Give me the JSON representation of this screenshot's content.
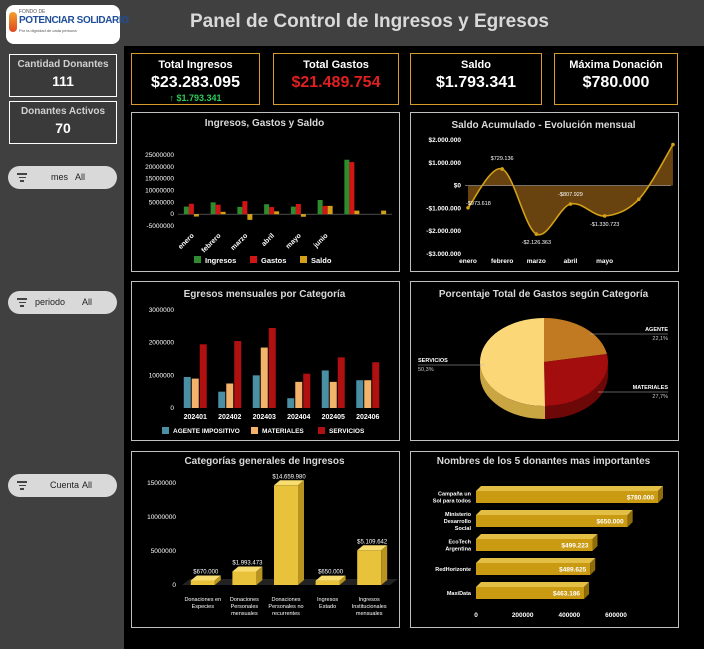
{
  "header": {
    "title": "Panel de Control de Ingresos y Egresos"
  },
  "logo": {
    "small": "FONDO DE",
    "main": "POTENCIAR SOLIDARIO",
    "sub": "Por la dignidad de cada persona"
  },
  "sidebar": {
    "stats": [
      {
        "label": "Cantidad Donantes",
        "value": "111"
      },
      {
        "label": "Donantes Activos",
        "value": "70"
      }
    ],
    "slicers": [
      {
        "label": "mes",
        "value": "All"
      },
      {
        "label": "periodo",
        "value": "All"
      },
      {
        "label": "Cuenta",
        "value": "All"
      }
    ]
  },
  "kpis": [
    {
      "label": "Total Ingresos",
      "value": "$23.283.095",
      "sub": "$1.793.341",
      "color": "#ffffff"
    },
    {
      "label": "Total Gastos",
      "value": "$21.489.754",
      "color": "#e02020"
    },
    {
      "label": "Saldo",
      "value": "$1.793.341",
      "color": "#ffffff"
    },
    {
      "label": "Máxima Donación",
      "value": "$780.000",
      "color": "#ffffff"
    }
  ],
  "colors": {
    "ingresos": "#2e8b2e",
    "gastos": "#d11414",
    "saldo": "#d4a017",
    "agente": "#4a8fa3",
    "materiales": "#f4b36a",
    "servicios": "#b01010",
    "gold": "#e8c23a",
    "donor": "#c99a12"
  },
  "chart_data": [
    {
      "type": "bar",
      "title": "Ingresos, Gastos y Saldo",
      "categories": [
        "enero",
        "febrero",
        "marzo",
        "abril",
        "mayo",
        "junio",
        "",
        ""
      ],
      "series": [
        {
          "name": "Ingresos",
          "values": [
            3200000,
            5000000,
            3100000,
            4200000,
            3200000,
            6000000,
            23000000,
            0
          ]
        },
        {
          "name": "Gastos",
          "values": [
            4400000,
            4000000,
            5500000,
            3000000,
            4300000,
            3500000,
            22000000,
            0
          ]
        },
        {
          "name": "Saldo",
          "values": [
            -1000000,
            1000000,
            -2400000,
            1200000,
            -1100000,
            3500000,
            1500000,
            1500000
          ]
        }
      ],
      "yticks": [
        "25000000",
        "20000000",
        "15000000",
        "10000000",
        "5000000",
        "0",
        "-5000000"
      ],
      "ylim": [
        -5000000,
        25000000
      ]
    },
    {
      "type": "area",
      "title": "Saldo Acumulado - Evolución mensual",
      "categories": [
        "enero",
        "febrero",
        "marzo",
        "abril",
        "mayo",
        "",
        ""
      ],
      "values": [
        -973618,
        729136,
        -2126363,
        -807929,
        -1330723,
        -600000,
        1800000
      ],
      "labels": [
        "-$973.618",
        "$729.136",
        "-$2.126.363",
        "-$807.929",
        "-$1.330.723"
      ],
      "yticks": [
        "$2.000.000",
        "$1.000.000",
        "$0",
        "-$1.000.000",
        "-$2.000.000",
        "-$3.000.000"
      ],
      "ylim": [
        -3000000,
        2000000
      ]
    },
    {
      "type": "bar",
      "title": "Egresos mensuales por Categoría",
      "categories": [
        "202401",
        "202402",
        "202403",
        "202404",
        "202405",
        "202406"
      ],
      "series": [
        {
          "name": "AGENTE IMPOSITIVO",
          "values": [
            950000,
            500000,
            1000000,
            300000,
            1150000,
            850000
          ]
        },
        {
          "name": "MATERIALES",
          "values": [
            900000,
            750000,
            1850000,
            800000,
            800000,
            850000
          ]
        },
        {
          "name": "SERVICIOS",
          "values": [
            1950000,
            2050000,
            2450000,
            1050000,
            1550000,
            1400000
          ]
        }
      ],
      "yticks": [
        "3000000",
        "2000000",
        "1000000",
        "0"
      ],
      "ylim": [
        0,
        3000000
      ]
    },
    {
      "type": "pie",
      "title": "Porcentaje Total de Gastos según Categoría",
      "slices": [
        {
          "label": "AGENTE",
          "value": 22.1,
          "text": "22,1%"
        },
        {
          "label": "MATERIALES",
          "value": 27.7,
          "text": "27,7%"
        },
        {
          "label": "SERVICIOS",
          "value": 50.3,
          "text": "50,3%"
        }
      ]
    },
    {
      "type": "bar",
      "title": "Categorías generales de Ingresos",
      "categories": [
        "Donaciones en Especies",
        "Donaciones Personales mensuales",
        "Donaciones Personales no recurrentes",
        "Ingresos Estado",
        "Ingresos Institucionales mensuales"
      ],
      "values": [
        670000,
        1993473,
        14659980,
        650000,
        5109642
      ],
      "labels": [
        "$670.000",
        "$1.993.473",
        "$14.659.980",
        "$650.000",
        "$5.109.642"
      ],
      "yticks": [
        "15000000",
        "10000000",
        "5000000",
        "0"
      ],
      "ylim": [
        0,
        15000000
      ]
    },
    {
      "type": "bar",
      "orientation": "horizontal",
      "title": "Nombres de los 5 donantes mas importantes",
      "categories": [
        "Campaña un Sol para todos",
        "Ministerio Desarrollo Social",
        "EcoTech Argentina",
        "RedHorizonte",
        "MaxiData"
      ],
      "values": [
        780000,
        650000,
        499223,
        489625,
        463186
      ],
      "labels": [
        "$780.000",
        "$650.000",
        "$499.223",
        "$489.625",
        "$463.186"
      ],
      "xticks": [
        "0",
        "200000",
        "400000",
        "600000"
      ],
      "xlim": [
        0,
        780000
      ]
    }
  ]
}
